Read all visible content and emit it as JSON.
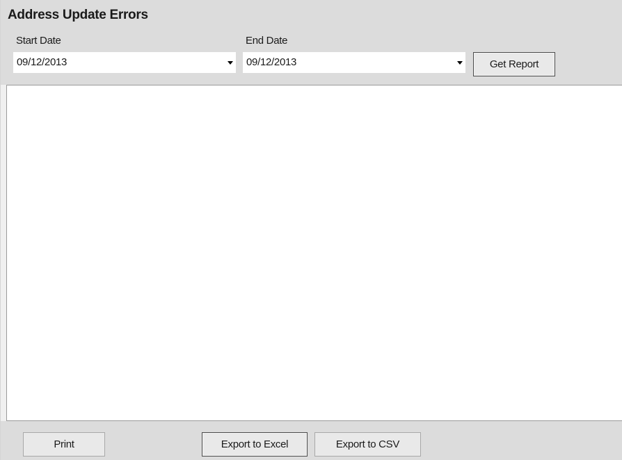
{
  "report": {
    "title": "Address Update Errors"
  },
  "filters": {
    "start_date": {
      "label": "Start Date",
      "value": "09/12/2013"
    },
    "end_date": {
      "label": "End Date",
      "value": "09/12/2013"
    }
  },
  "toolbar": {
    "get_report_label": "Get Report"
  },
  "footer": {
    "print_label": "Print",
    "export_excel_label": "Export to Excel",
    "export_csv_label": "Export to CSV"
  },
  "icons": {
    "dropdown": "chevron-down-icon"
  }
}
